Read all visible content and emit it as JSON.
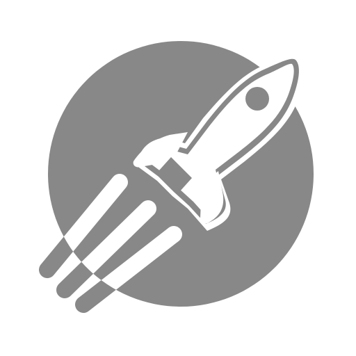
{
  "icon": {
    "name": "rocket-planet-icon",
    "colors": {
      "background": "#ffffff",
      "foreground": "#888888"
    }
  }
}
